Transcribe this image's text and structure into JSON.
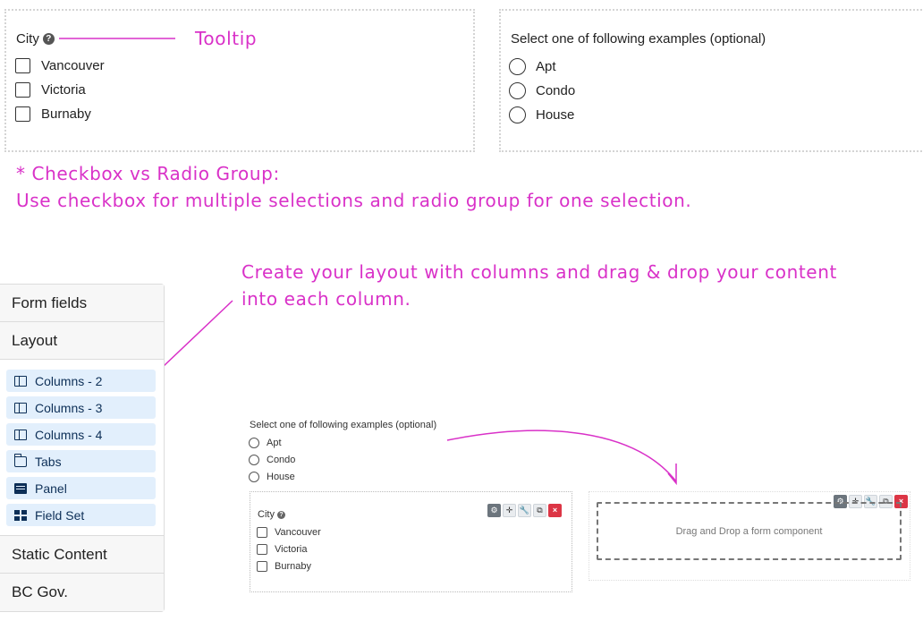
{
  "top_left": {
    "label": "City",
    "help_glyph": "?",
    "options": [
      "Vancouver",
      "Victoria",
      "Burnaby"
    ]
  },
  "top_right": {
    "label": "Select one of following examples (optional)",
    "options": [
      "Apt",
      "Condo",
      "House"
    ]
  },
  "annotations": {
    "tooltip": "Tooltip",
    "checkbox_vs_radio_line1": "* Checkbox vs Radio Group:",
    "checkbox_vs_radio_line2": "Use checkbox for multiple selections and radio group for one selection.",
    "layout_line1": "Create your layout with columns and drag & drop your content",
    "layout_line2": "into each column.",
    "accent_color": "#d931c8"
  },
  "sidebar": {
    "form_fields": "Form fields",
    "layout": "Layout",
    "items": [
      {
        "label": "Columns - 2",
        "icon": "columns-icon"
      },
      {
        "label": "Columns - 3",
        "icon": "columns-icon"
      },
      {
        "label": "Columns - 4",
        "icon": "columns-icon"
      },
      {
        "label": "Tabs",
        "icon": "folder-icon"
      },
      {
        "label": "Panel",
        "icon": "list-alt-icon"
      },
      {
        "label": "Field Set",
        "icon": "th-large-icon"
      }
    ],
    "static_content": "Static Content",
    "bc_gov": "BC Gov."
  },
  "mini_builder": {
    "radio_label": "Select one of following examples (optional)",
    "radio_options": [
      "Apt",
      "Condo",
      "House"
    ],
    "city_label": "City",
    "city_options": [
      "Vancouver",
      "Victoria",
      "Burnaby"
    ],
    "toolbar": {
      "gear": "⚙",
      "move": "✛",
      "edit": "🔧",
      "copy": "⧉",
      "remove": "×"
    },
    "dropzone_text": "Drag and Drop a form component"
  }
}
